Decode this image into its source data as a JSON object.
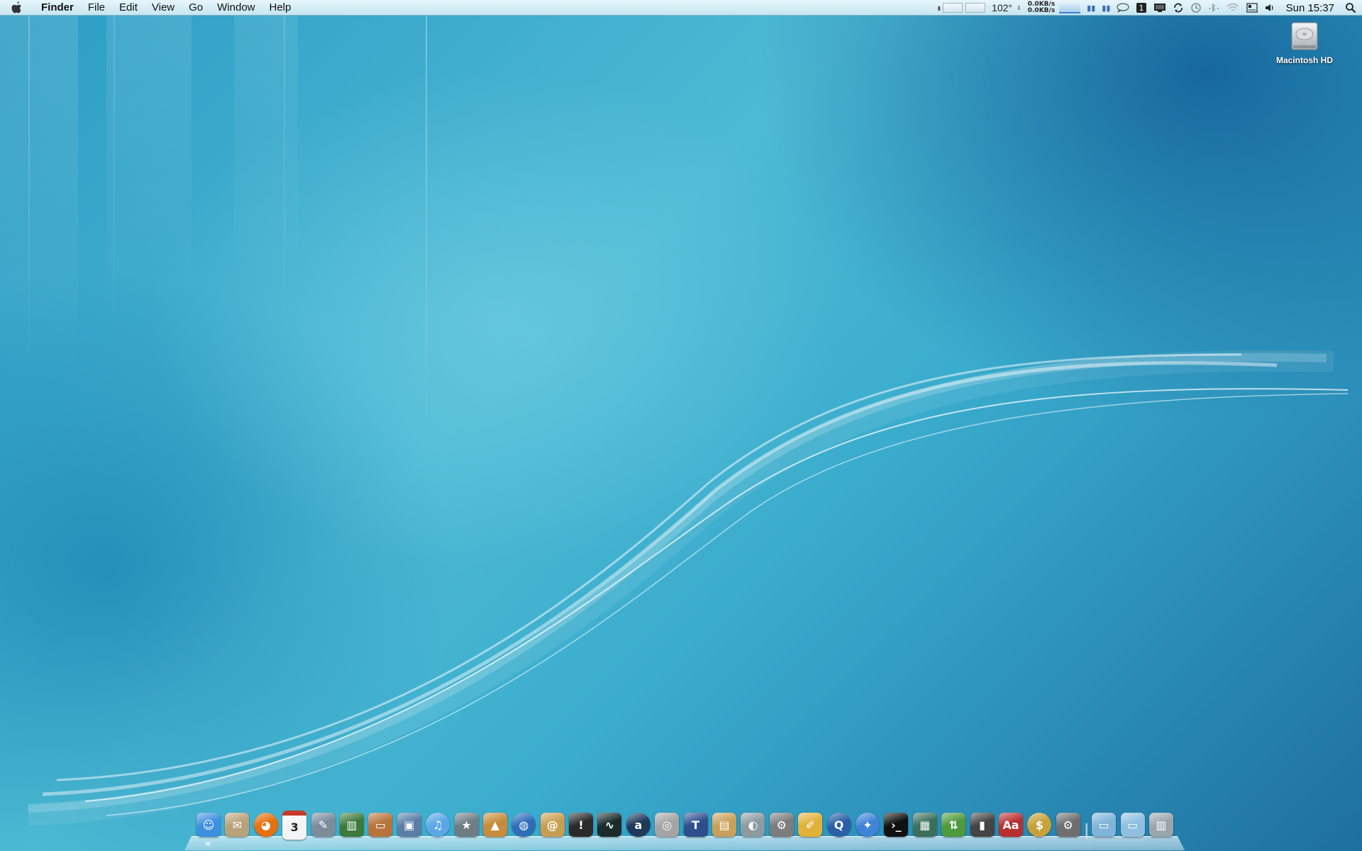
{
  "menubar": {
    "apple_icon": "apple-icon",
    "app_name": "Finder",
    "menus": [
      "File",
      "Edit",
      "View",
      "Go",
      "Window",
      "Help"
    ],
    "status": {
      "temperature": "102°",
      "net_up": "0.0KB/s",
      "net_down": "0.0KB/s",
      "clock": "Sun 15:37"
    }
  },
  "desktop": {
    "icons": [
      {
        "label": "Macintosh HD",
        "icon": "hard-drive-icon"
      }
    ]
  },
  "dock": {
    "items": [
      {
        "name": "finder",
        "glyph": "☺",
        "color": "#3d8fe0"
      },
      {
        "name": "mail-stamp",
        "glyph": "✉",
        "color": "#b9a27a"
      },
      {
        "name": "firefox",
        "glyph": "◕",
        "color": "#e8700f"
      },
      {
        "name": "ical",
        "glyph": "3",
        "color": "#f4f4f4"
      },
      {
        "name": "script-editor",
        "glyph": "✎",
        "color": "#7b8c9a"
      },
      {
        "name": "numbers",
        "glyph": "▥",
        "color": "#3c7a3c"
      },
      {
        "name": "keynote",
        "glyph": "▭",
        "color": "#b8733d"
      },
      {
        "name": "image-capture",
        "glyph": "▣",
        "color": "#5a7ea8"
      },
      {
        "name": "itunes",
        "glyph": "♫",
        "color": "#5aa8e6"
      },
      {
        "name": "imovie-star",
        "glyph": "★",
        "color": "#6f7c84"
      },
      {
        "name": "iphoto",
        "glyph": "▲",
        "color": "#c68c3a"
      },
      {
        "name": "google-earth",
        "glyph": "◍",
        "color": "#2f6db9"
      },
      {
        "name": "address-book",
        "glyph": "@",
        "color": "#c89e52"
      },
      {
        "name": "console",
        "glyph": "!",
        "color": "#2b2b2b"
      },
      {
        "name": "activity-monitor",
        "glyph": "∿",
        "color": "#1b2b2b"
      },
      {
        "name": "aperture-a",
        "glyph": "a",
        "color": "#1f3a5a"
      },
      {
        "name": "photo-booth",
        "glyph": "◎",
        "color": "#a4a4a4"
      },
      {
        "name": "final-cut",
        "glyph": "T",
        "color": "#2e4e8c"
      },
      {
        "name": "photo-album",
        "glyph": "▤",
        "color": "#c8a05a"
      },
      {
        "name": "disk-utility",
        "glyph": "◐",
        "color": "#8d9aa2"
      },
      {
        "name": "automator",
        "glyph": "⚙",
        "color": "#7c7c7c"
      },
      {
        "name": "pages",
        "glyph": "✐",
        "color": "#e0b23a"
      },
      {
        "name": "quicktime",
        "glyph": "Q",
        "color": "#2c5fa8"
      },
      {
        "name": "safari",
        "glyph": "✦",
        "color": "#3f84d8"
      },
      {
        "name": "terminal",
        "glyph": "›_",
        "color": "#111"
      },
      {
        "name": "spaces",
        "glyph": "▦",
        "color": "#3a6f5a"
      },
      {
        "name": "ftp-client",
        "glyph": "⇅",
        "color": "#4f9a3c"
      },
      {
        "name": "flash-drive",
        "glyph": "▮",
        "color": "#444"
      },
      {
        "name": "dictionary",
        "glyph": "Aa",
        "color": "#b72f2f"
      },
      {
        "name": "currency",
        "glyph": "$",
        "color": "#c6a23a"
      },
      {
        "name": "system-preferences",
        "glyph": "⚙",
        "color": "#6e6e6e"
      }
    ],
    "right_items": [
      {
        "name": "applications-stack",
        "glyph": "▭",
        "color": "#7fb4d8"
      },
      {
        "name": "documents-folder",
        "glyph": "▭",
        "color": "#8fc0e0"
      },
      {
        "name": "trash",
        "glyph": "▥",
        "color": "#9aa6ad"
      }
    ]
  },
  "colors": {
    "menubar_top": "#e8f6fb",
    "menubar_bottom": "#c6e6f1",
    "desktop_base": "#3aaccd"
  }
}
